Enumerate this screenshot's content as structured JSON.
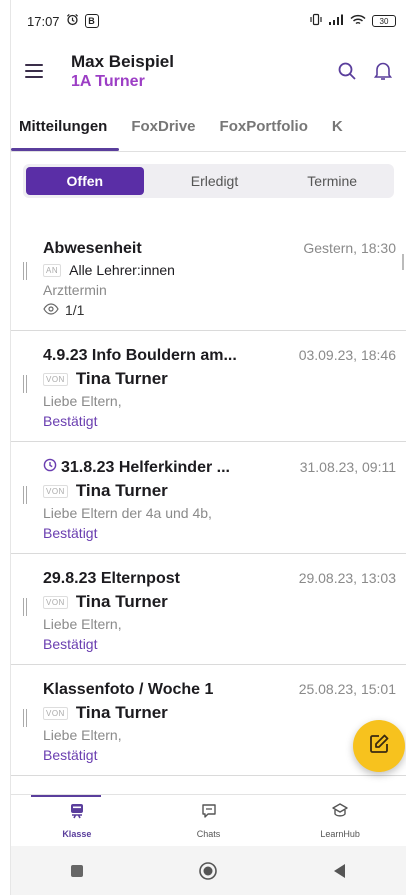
{
  "status_bar": {
    "time": "17:07",
    "battery": "30"
  },
  "header": {
    "user_name": "Max Beispiel",
    "class_name": "1A Turner"
  },
  "tabs": [
    {
      "label": "Mitteilungen",
      "active": true
    },
    {
      "label": "FoxDrive",
      "active": false
    },
    {
      "label": "FoxPortfolio",
      "active": false
    },
    {
      "label": "K",
      "active": false
    }
  ],
  "segments": [
    {
      "label": "Offen",
      "active": true
    },
    {
      "label": "Erledigt",
      "active": false
    },
    {
      "label": "Termine",
      "active": false
    }
  ],
  "messages": [
    {
      "subject": "Abwesenheit",
      "date": "Gestern, 18:30",
      "tag": "AN",
      "person": "Alle Lehrer:innen",
      "preview": "Arzttermin",
      "reads": "1/1"
    },
    {
      "subject": "4.9.23 Info Bouldern am...",
      "date": "03.09.23, 18:46",
      "tag": "VON",
      "person": "Tina Turner",
      "preview": "Liebe Eltern,",
      "status": "Bestätigt"
    },
    {
      "subject": "31.8.23 Helferkinder ...",
      "date": "31.08.23, 09:11",
      "tag": "VON",
      "person": "Tina Turner",
      "preview": "Liebe Eltern der 4a und 4b,",
      "status": "Bestätigt"
    },
    {
      "subject": "29.8.23 Elternpost",
      "date": "29.08.23, 13:03",
      "tag": "VON",
      "person": "Tina Turner",
      "preview": "Liebe Eltern,",
      "status": "Bestätigt"
    },
    {
      "subject": "Klassenfoto / Woche 1",
      "date": "25.08.23, 15:01",
      "tag": "VON",
      "person": "Tina Turner",
      "preview": "Liebe Eltern,",
      "status": "Bestätigt"
    }
  ],
  "bottom_nav": [
    {
      "label": "Klasse",
      "icon": "class-icon",
      "active": true
    },
    {
      "label": "Chats",
      "icon": "chat-icon",
      "active": false
    },
    {
      "label": "LearnHub",
      "icon": "learnhub-icon",
      "active": false
    }
  ],
  "colors": {
    "accent": "#5a2ea6",
    "class_name": "#9c3ec5",
    "fab": "#f7c21e",
    "link": "#6a3eb0"
  }
}
